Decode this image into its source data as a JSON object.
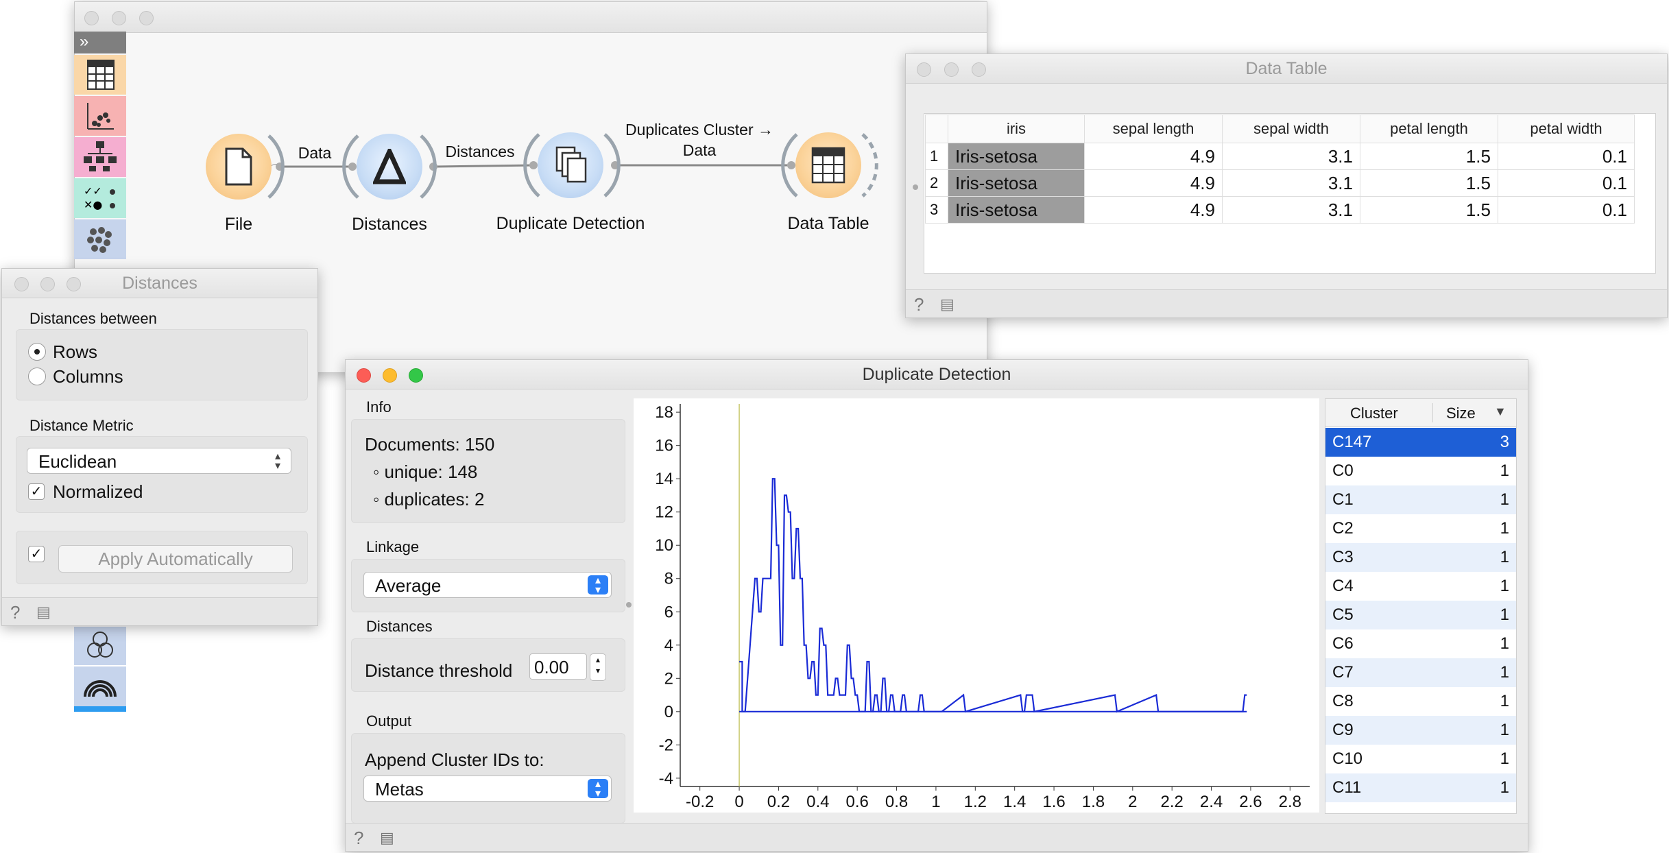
{
  "canvas": {
    "nodes": [
      {
        "label": "File",
        "icon": "file-icon"
      },
      {
        "label": "Distances",
        "icon": "delta-icon"
      },
      {
        "label": "Duplicate Detection",
        "icon": "documents-icon"
      },
      {
        "label": "Data Table",
        "icon": "table-icon"
      }
    ],
    "links": [
      {
        "label": "Data"
      },
      {
        "label": "Distances"
      },
      {
        "label_line1": "Duplicates Cluster →",
        "label_line2": "Data"
      }
    ]
  },
  "distances_window": {
    "title": "Distances",
    "between_label": "Distances between",
    "rows_label": "Rows",
    "columns_label": "Columns",
    "selected": "Rows",
    "metric_label": "Distance Metric",
    "metric_value": "Euclidean",
    "normalized_label": "Normalized",
    "normalized_checked": true,
    "apply_checked": true,
    "apply_label": "Apply Automatically"
  },
  "data_table_window": {
    "title": "Data Table",
    "columns": [
      "iris",
      "sepal length",
      "sepal width",
      "petal length",
      "petal width"
    ],
    "rows": [
      {
        "index": "1",
        "iris": "Iris-setosa",
        "sl": "4.9",
        "sw": "3.1",
        "pl": "1.5",
        "pw": "0.1"
      },
      {
        "index": "2",
        "iris": "Iris-setosa",
        "sl": "4.9",
        "sw": "3.1",
        "pl": "1.5",
        "pw": "0.1"
      },
      {
        "index": "3",
        "iris": "Iris-setosa",
        "sl": "4.9",
        "sw": "3.1",
        "pl": "1.5",
        "pw": "0.1"
      }
    ]
  },
  "dup_window": {
    "title": "Duplicate Detection",
    "info_label": "Info",
    "documents": "Documents: 150",
    "unique": "◦ unique: 148",
    "duplicates": "◦ duplicates: 2",
    "linkage_label": "Linkage",
    "linkage_value": "Average",
    "distances_label": "Distances",
    "threshold_label": "Distance threshold",
    "threshold_value": "0.00",
    "output_label": "Output",
    "append_label": "Append Cluster IDs to:",
    "append_value": "Metas",
    "cluster_header": "Cluster",
    "size_header": "Size",
    "clusters": [
      {
        "name": "C147",
        "size": "3",
        "selected": true
      },
      {
        "name": "C0",
        "size": "1"
      },
      {
        "name": "C1",
        "size": "1"
      },
      {
        "name": "C2",
        "size": "1"
      },
      {
        "name": "C3",
        "size": "1"
      },
      {
        "name": "C4",
        "size": "1"
      },
      {
        "name": "C5",
        "size": "1"
      },
      {
        "name": "C6",
        "size": "1"
      },
      {
        "name": "C7",
        "size": "1"
      },
      {
        "name": "C8",
        "size": "1"
      },
      {
        "name": "C9",
        "size": "1"
      },
      {
        "name": "C10",
        "size": "1"
      },
      {
        "name": "C11",
        "size": "1"
      }
    ]
  },
  "chart_data": {
    "type": "line",
    "title": "",
    "xlabel": "",
    "ylabel": "",
    "xlim": [
      -0.3,
      2.9
    ],
    "ylim": [
      -4.5,
      18.5
    ],
    "xticks": [
      "-0.2",
      "0",
      "0.2",
      "0.4",
      "0.6",
      "0.8",
      "1",
      "1.2",
      "1.4",
      "1.6",
      "1.8",
      "2",
      "2.2",
      "2.4",
      "2.6",
      "2.8"
    ],
    "xtick_values": [
      -0.2,
      0,
      0.2,
      0.4,
      0.6,
      0.8,
      1,
      1.2,
      1.4,
      1.6,
      1.8,
      2,
      2.2,
      2.4,
      2.6,
      2.8
    ],
    "yticks": [
      "18",
      "16",
      "14",
      "12",
      "10",
      "8",
      "6",
      "4",
      "2",
      "0",
      "-2",
      "-4"
    ],
    "ytick_values": [
      18,
      16,
      14,
      12,
      10,
      8,
      6,
      4,
      2,
      0,
      -2,
      -4
    ],
    "threshold_x": 0.0,
    "series": [
      {
        "x": [
          0,
          0.015,
          0.015,
          0.03,
          0.08,
          0.09,
          0.1,
          0.11,
          0.12,
          0.13,
          0.14,
          0.15,
          0.16,
          0.17,
          0.18,
          0.19,
          0.2,
          0.21,
          0.22,
          0.23,
          0.24,
          0.25,
          0.26,
          0.27,
          0.28,
          0.29,
          0.3,
          0.31,
          0.32,
          0.33,
          0.34,
          0.35,
          0.36,
          0.37,
          0.38,
          0.39,
          0.4,
          0.41,
          0.42,
          0.43,
          0.44,
          0.45,
          0.46,
          0.47,
          0.48,
          0.49,
          0.5,
          0.51,
          0.52,
          0.53,
          0.54,
          0.55,
          0.56,
          0.57,
          0.58,
          0.59,
          0.6,
          0.61,
          0.62,
          0.63,
          0.64,
          0.65,
          0.66,
          0.67,
          0.68,
          0.69,
          0.7,
          0.71,
          0.72,
          0.73,
          0.74,
          0.75,
          0.76,
          0.77,
          0.78,
          0.79,
          0.8,
          0.81,
          0.82,
          0.83,
          0.84,
          0.85,
          0.86,
          0.87,
          0.88,
          0.89,
          0.9,
          0.91,
          0.92,
          0.93,
          0.94,
          0.95,
          0.96,
          0.97,
          0.98,
          0.99,
          1.0,
          1.01,
          1.02,
          1.03,
          1.14,
          1.15,
          1.43,
          1.44,
          1.45,
          1.46,
          1.49,
          1.5,
          1.91,
          1.92,
          2.12,
          2.13,
          2.56,
          2.57,
          2.58
        ],
        "y": [
          3,
          3,
          0,
          0,
          8,
          8,
          6,
          6,
          8,
          8,
          8,
          8,
          8,
          14,
          14,
          10,
          10,
          4,
          4,
          13,
          13,
          12,
          12,
          8,
          8,
          11,
          11,
          8,
          8,
          4,
          4,
          2,
          2,
          3,
          3,
          1,
          1,
          5,
          5,
          4,
          4,
          1,
          1,
          1,
          1,
          2,
          2,
          1,
          1,
          1,
          1,
          4,
          4,
          2,
          2,
          1,
          1,
          0,
          0,
          0,
          0,
          3,
          3,
          0,
          0,
          1,
          1,
          0,
          0,
          2,
          2,
          0,
          0,
          1,
          1,
          0,
          0,
          0,
          0,
          1,
          1,
          0,
          0,
          0,
          0,
          0,
          0,
          0,
          1,
          1,
          0,
          0,
          0,
          0,
          0,
          0,
          0,
          0,
          0,
          0,
          1,
          0,
          1,
          0,
          0,
          1,
          1,
          0,
          1,
          0,
          1,
          0,
          0,
          1,
          1
        ]
      }
    ]
  }
}
